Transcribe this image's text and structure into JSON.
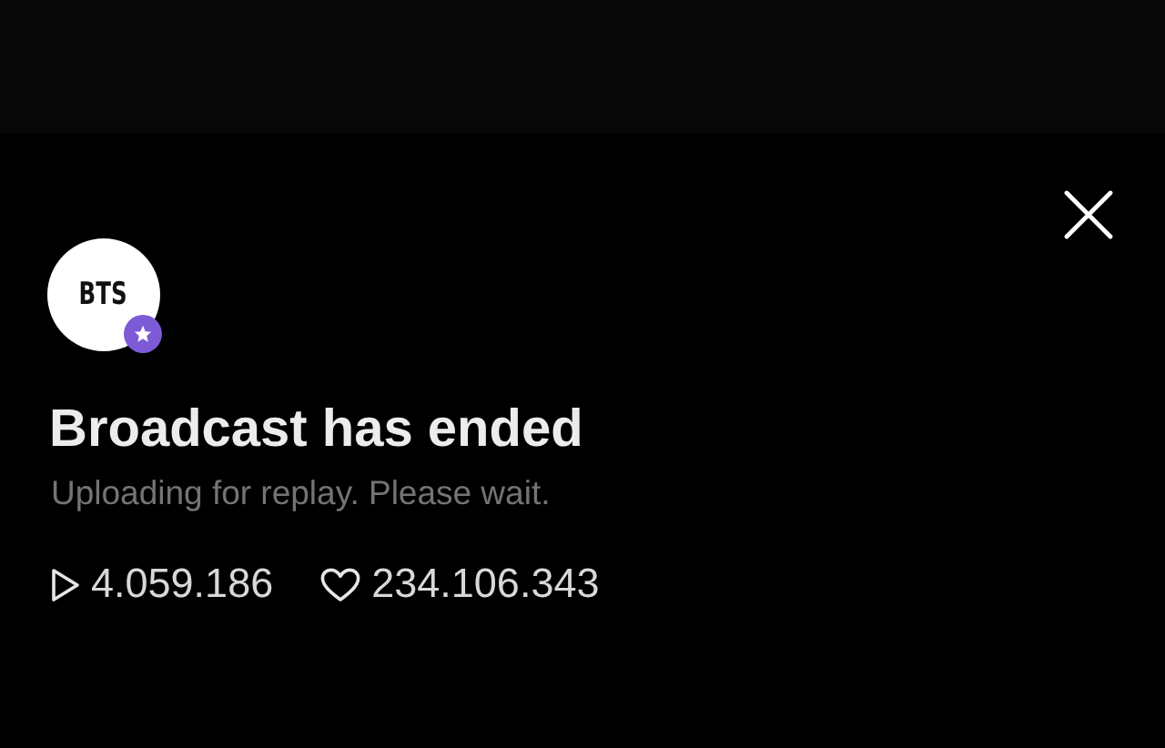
{
  "channel": {
    "avatar_text": "BTS",
    "verified": true
  },
  "title": "Broadcast has ended",
  "subtitle": "Uploading for replay. Please wait.",
  "stats": [
    {
      "kind": "plays",
      "value": "4.059.186"
    },
    {
      "kind": "likes",
      "value": "234.106.343"
    }
  ]
}
